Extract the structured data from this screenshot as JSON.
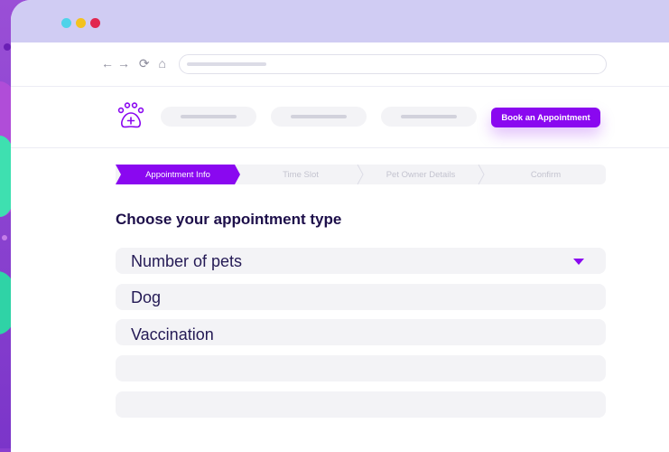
{
  "header": {
    "book_button": "Book an Appointment"
  },
  "steps": [
    {
      "label": "Appointment Info",
      "active": true
    },
    {
      "label": "Time Slot",
      "active": false
    },
    {
      "label": "Pet Owner Details",
      "active": false
    },
    {
      "label": "Confirm",
      "active": false
    }
  ],
  "form": {
    "heading": "Choose your appointment type",
    "fields": [
      {
        "value": "Number of pets",
        "type": "select"
      },
      {
        "value": "Dog",
        "type": "input"
      },
      {
        "value": "Vaccination",
        "type": "input"
      },
      {
        "value": "",
        "type": "input"
      },
      {
        "value": "",
        "type": "input"
      }
    ]
  },
  "colors": {
    "accent": "#8a08f0",
    "titlebar": "#d0ccf3",
    "heading": "#1d0f4a"
  },
  "icons": [
    "back-arrow-icon",
    "forward-arrow-icon",
    "reload-icon",
    "home-icon",
    "paw-logo-icon",
    "dropdown-caret-icon"
  ]
}
